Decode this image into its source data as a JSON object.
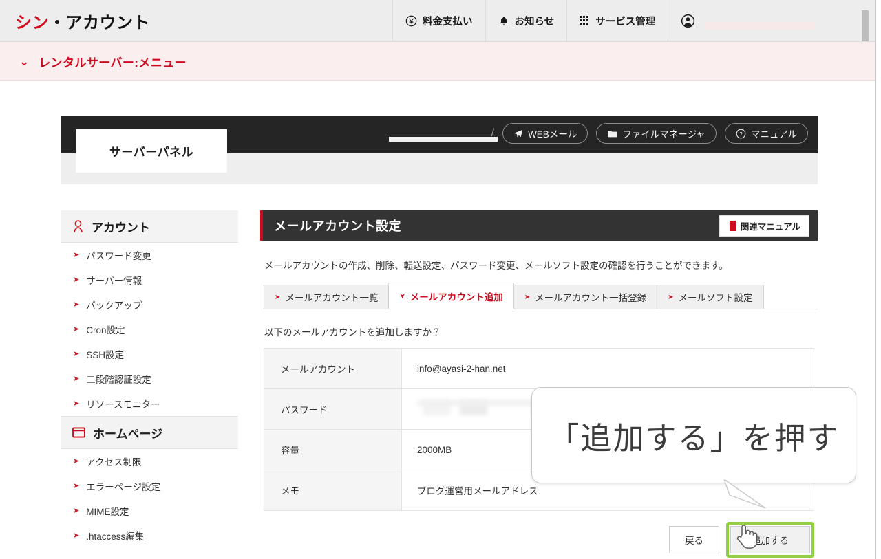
{
  "header": {
    "brand_red": "シン",
    "brand_sep": "・",
    "brand_dark": "アカウント",
    "nav": [
      {
        "label": "料金支払い",
        "icon": "yen-circle-icon"
      },
      {
        "label": "お知らせ",
        "icon": "bell-icon"
      },
      {
        "label": "サービス管理",
        "icon": "grid-icon"
      }
    ],
    "account_icon": "person-circle-icon",
    "account_name_redacted": ""
  },
  "menubar": {
    "chevron": "⌄",
    "label": "レンタルサーバー:メニュー"
  },
  "server_panel": {
    "logo_text": "サーバーパネル",
    "separator": "/",
    "buttons": [
      {
        "label": "WEBメール",
        "icon": "paper-plane-icon"
      },
      {
        "label": "ファイルマネージャ",
        "icon": "folder-icon"
      },
      {
        "label": "マニュアル",
        "icon": "question-circle-icon"
      }
    ]
  },
  "sidebar": {
    "sections": [
      {
        "title": "アカウント",
        "icon": "person-icon",
        "items": [
          "パスワード変更",
          "サーバー情報",
          "バックアップ",
          "Cron設定",
          "SSH設定",
          "二段階認証設定",
          "リソースモニター"
        ]
      },
      {
        "title": "ホームページ",
        "icon": "window-icon",
        "items": [
          "アクセス制限",
          "エラーページ設定",
          "MIME設定",
          ".htaccess編集"
        ]
      }
    ]
  },
  "main": {
    "title": "メールアカウント設定",
    "manual_button": "関連マニュアル",
    "lead": "メールアカウントの作成、削除、転送設定、パスワード変更、メールソフト設定の確認を行うことができます。",
    "tabs": [
      {
        "label": "メールアカウント一覧",
        "active": false
      },
      {
        "label": "メールアカウント追加",
        "active": true
      },
      {
        "label": "メールアカウント一括登録",
        "active": false
      },
      {
        "label": "メールソフト設定",
        "active": false
      }
    ],
    "question": "以下のメールアカウントを追加しますか？",
    "table": {
      "rows": [
        {
          "label": "メールアカウント",
          "value": "info@ayasi-2-han.net"
        },
        {
          "label": "パスワード",
          "value": "",
          "masked": true
        },
        {
          "label": "容量",
          "value": "2000MB"
        },
        {
          "label": "メモ",
          "value": "ブログ運営用メールアドレス"
        }
      ]
    },
    "buttons": {
      "back": "戻る",
      "submit": "追加する"
    }
  },
  "callout": {
    "text": "「追加する」を押す"
  },
  "colors": {
    "brand_red": "#d60b1e",
    "accent_red": "#cc0d20",
    "dark_bar": "#252525",
    "panel_head": "#333333",
    "menubar_bg": "#fbeeee",
    "highlight_green": "#8ed23f"
  }
}
